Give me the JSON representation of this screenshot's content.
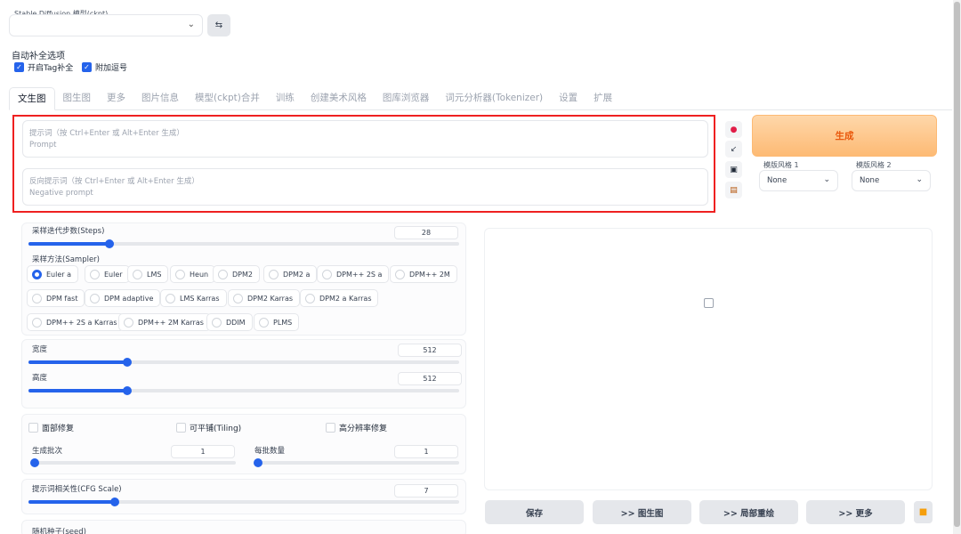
{
  "model": {
    "label": "Stable Diffusion 模型(ckpt)",
    "value": ""
  },
  "autocomplete": {
    "title": "自动补全选项",
    "options": [
      {
        "label": "开启Tag补全",
        "checked": true
      },
      {
        "label": "附加逗号",
        "checked": true
      }
    ]
  },
  "tabs": [
    "文生图",
    "图生图",
    "更多",
    "图片信息",
    "模型(ckpt)合并",
    "训练",
    "创建美术风格",
    "图库浏览器",
    "词元分析器(Tokenizer)",
    "设置",
    "扩展"
  ],
  "active_tab": "文生图",
  "prompt": {
    "placeholder_cn": "提示词（按 Ctrl+Enter 或 Alt+Enter 生成）",
    "placeholder_en": "Prompt"
  },
  "negative_prompt": {
    "placeholder_cn": "反向提示词（按 Ctrl+Enter 或 Alt+Enter 生成）",
    "placeholder_en": "Negative prompt"
  },
  "generate_label": "生成",
  "styles": [
    {
      "label": "模版风格 1",
      "value": "None"
    },
    {
      "label": "模版风格 2",
      "value": "None"
    }
  ],
  "steps": {
    "label": "采样迭代步数(Steps)",
    "value": "28",
    "fraction": 0.187
  },
  "sampler": {
    "label": "采样方法(Sampler)",
    "selected": "Euler a",
    "options": [
      "Euler a",
      "Euler",
      "LMS",
      "Heun",
      "DPM2",
      "DPM2 a",
      "DPM++ 2S a",
      "DPM++ 2M",
      "DPM fast",
      "DPM adaptive",
      "LMS Karras",
      "DPM2 Karras",
      "DPM2 a Karras",
      "DPM++ 2S a Karras",
      "DPM++ 2M Karras",
      "DDIM",
      "PLMS"
    ]
  },
  "width": {
    "label": "宽度",
    "value": "512",
    "fraction": 0.23
  },
  "height": {
    "label": "高度",
    "value": "512",
    "fraction": 0.23
  },
  "options": [
    {
      "label": "面部修复",
      "checked": false
    },
    {
      "label": "可平铺(Tiling)",
      "checked": false
    },
    {
      "label": "高分辨率修复",
      "checked": false
    }
  ],
  "batch_count": {
    "label": "生成批次",
    "value": "1",
    "fraction": 0.0
  },
  "batch_size": {
    "label": "每批数量",
    "value": "1",
    "fraction": 0.0
  },
  "cfg": {
    "label": "提示词相关性(CFG Scale)",
    "value": "7",
    "fraction": 0.2
  },
  "seed": {
    "label": "随机种子(seed)"
  },
  "actions": [
    "保存",
    ">> 图生图",
    ">> 局部重绘",
    ">> 更多"
  ],
  "colors": {
    "accent": "#2563eb",
    "generate": "#fdba74",
    "highlight": "#ef2020"
  }
}
